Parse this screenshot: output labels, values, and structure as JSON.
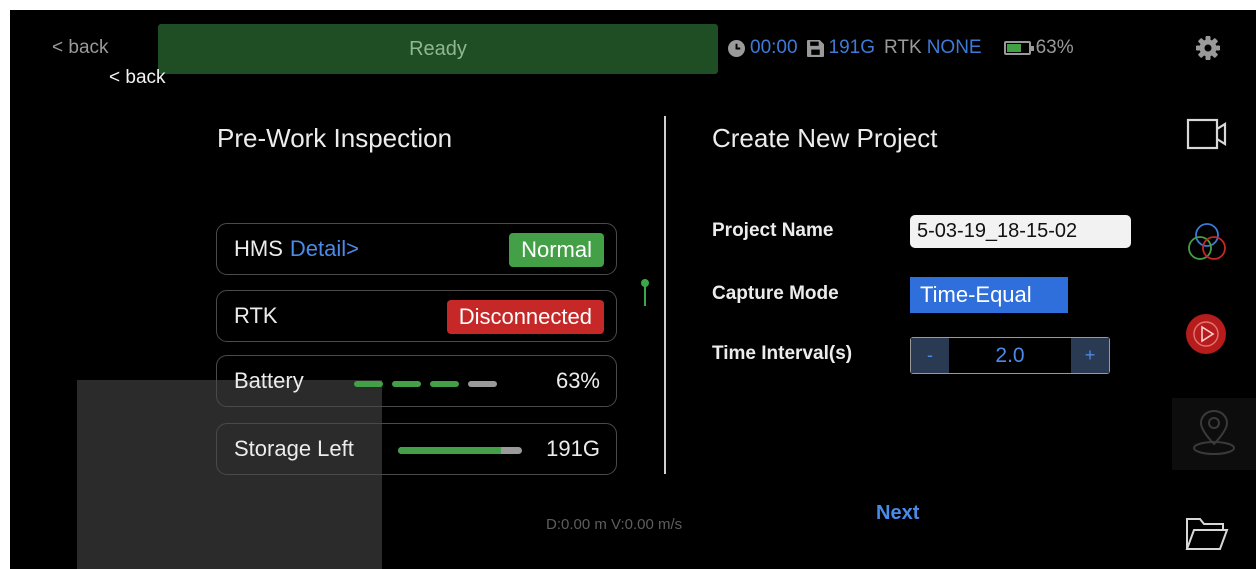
{
  "header": {
    "back_top": "< back",
    "back_overlay": "< back",
    "status": "Ready",
    "timer": "00:00",
    "storage": "191G",
    "rtk_label": "RTK",
    "rtk_value": "NONE",
    "battery_percent": "63%",
    "battery_level": 0.63
  },
  "inspection": {
    "title": "Pre-Work Inspection",
    "hms_label": "HMS",
    "hms_detail": "Detail>",
    "hms_status": "Normal",
    "rtk_label": "RTK",
    "rtk_status": "Disconnected",
    "battery_label": "Battery",
    "battery_value": "63%",
    "battery_segments_filled": 3,
    "battery_segments_total": 4,
    "storage_label": "Storage Left",
    "storage_value": "191G",
    "storage_fraction": 0.83
  },
  "telemetry": "D:0.00 m V:0.00 m/s",
  "project": {
    "title": "Create New Project",
    "name_label": "Project Name",
    "name_value": "5-03-19_18-15-02",
    "mode_label": "Capture Mode",
    "mode_value": "Time-Equal",
    "interval_label": "Time Interval(s)",
    "interval_minus": "-",
    "interval_value": "2.0",
    "interval_plus": "+",
    "next_label": "Next"
  },
  "colors": {
    "accent": "#4a8ae8",
    "ok": "#43a047",
    "error": "#c62828",
    "status_bar": "#1f4d24"
  },
  "icons": [
    "clock-icon",
    "save-icon",
    "battery-icon",
    "gear-icon",
    "video-camera-icon",
    "color-circles-icon",
    "play-icon",
    "location-pin-icon",
    "folder-icon"
  ]
}
